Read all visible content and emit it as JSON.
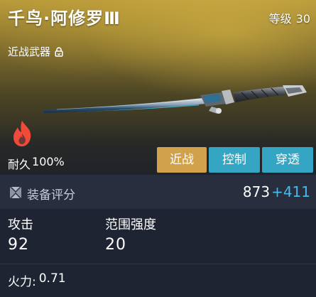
{
  "weapon": {
    "name": "千鸟·阿修罗Ⅲ",
    "level_label": "等级",
    "level_value": "30",
    "type_label": "近战武器",
    "durability_label": "耐久",
    "durability_value": "100%"
  },
  "tags": [
    {
      "label": "近战",
      "color": "#d2a14c"
    },
    {
      "label": "控制",
      "color": "#34a6c3"
    },
    {
      "label": "穿透",
      "color": "#34a6c3"
    }
  ],
  "score": {
    "label": "装备评分",
    "value": "873",
    "bonus": "+411"
  },
  "stats": {
    "attack_label": "攻击",
    "attack_value": "92",
    "range_label": "范围强度",
    "range_value": "20",
    "firepower_label": "火力:",
    "firepower_value": "0.71"
  },
  "icons": {
    "lock": "lock-icon",
    "flame": "flame-icon",
    "score": "score-emblem-icon",
    "weapon": "katana-image"
  },
  "colors": {
    "accent_gold": "#d2a14c",
    "accent_cyan": "#34a6c3",
    "bonus_blue": "#4ab8e8"
  }
}
